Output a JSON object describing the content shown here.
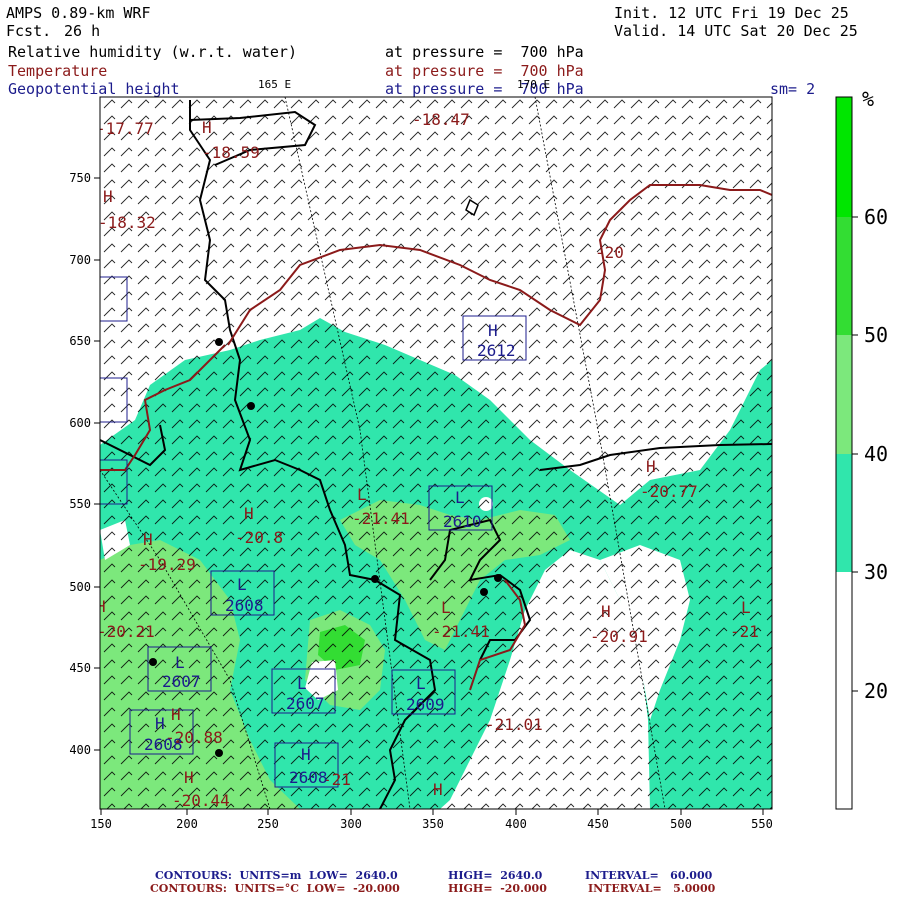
{
  "header": {
    "model": "AMPS 0.89-km WRF",
    "fcst_label": "Fcst.",
    "fcst_value": "26 h",
    "init": "Init. 12 UTC Fri 19 Dec 25",
    "valid": "Valid. 14 UTC Sat 20 Dec 25",
    "field1": "Relative humidity (w.r.t. water)",
    "field1_level": "at pressure =  700 hPa",
    "field2": "Temperature",
    "field2_level": "at pressure =  700 hPa",
    "field3": "Geopotential height",
    "field3_level": "at pressure =  700 hPa",
    "lon_label_1": "165 E",
    "lon_label_2": "170 E",
    "smoothing": "sm= 2"
  },
  "colorbar": {
    "unit": "%",
    "ticks": [
      "60",
      "50",
      "40",
      "30",
      "20"
    ],
    "colors": [
      "#00e600",
      "#33dd33",
      "#7ce87c",
      "#30e6ac",
      "#ffffff"
    ]
  },
  "axes": {
    "x_ticks": [
      "150",
      "200",
      "250",
      "300",
      "350",
      "400",
      "450",
      "500",
      "550"
    ],
    "y_ticks": [
      "750",
      "700",
      "650",
      "600",
      "550",
      "500",
      "450",
      "400"
    ]
  },
  "temperature_labels": [
    {
      "id": "t1",
      "text": "-18.47"
    },
    {
      "id": "t2",
      "text": "-18.59"
    },
    {
      "id": "t3",
      "text": "-18.32"
    },
    {
      "id": "t4",
      "text": "-20"
    },
    {
      "id": "t5",
      "text": "-20.77"
    },
    {
      "id": "t6",
      "text": "-21.41"
    },
    {
      "id": "t7",
      "text": "-20.8"
    },
    {
      "id": "t8",
      "text": "-19.29"
    },
    {
      "id": "t9",
      "text": "-20.21"
    },
    {
      "id": "t10",
      "text": "-21.41"
    },
    {
      "id": "t11",
      "text": "-20.91"
    },
    {
      "id": "t12",
      "text": "-21"
    },
    {
      "id": "t13",
      "text": "-20.88"
    },
    {
      "id": "t14",
      "text": "-21.01"
    },
    {
      "id": "t15",
      "text": "-20.44"
    },
    {
      "id": "t16",
      "text": "-17.77"
    },
    {
      "id": "t17",
      "text": "-21"
    }
  ],
  "height_labels": [
    {
      "id": "g1",
      "text": "2612"
    },
    {
      "id": "g2",
      "text": "2610"
    },
    {
      "id": "g3",
      "text": "2608"
    },
    {
      "id": "g4",
      "text": "2607"
    },
    {
      "id": "g5",
      "text": "2607"
    },
    {
      "id": "g6",
      "text": "2609"
    },
    {
      "id": "g7",
      "text": "2608"
    },
    {
      "id": "g8",
      "text": "2608"
    }
  ],
  "footer": {
    "line1_a": "CONTOURS:  UNITS=m  LOW=  2640.0",
    "line1_b": "HIGH=  2640.0",
    "line1_c": "INTERVAL=   60.000",
    "line2_a": "CONTOURS:  UNITS=°C  LOW=  -20.000",
    "line2_b": "HIGH=  -20.000",
    "line2_c": "INTERVAL=   5.0000"
  }
}
